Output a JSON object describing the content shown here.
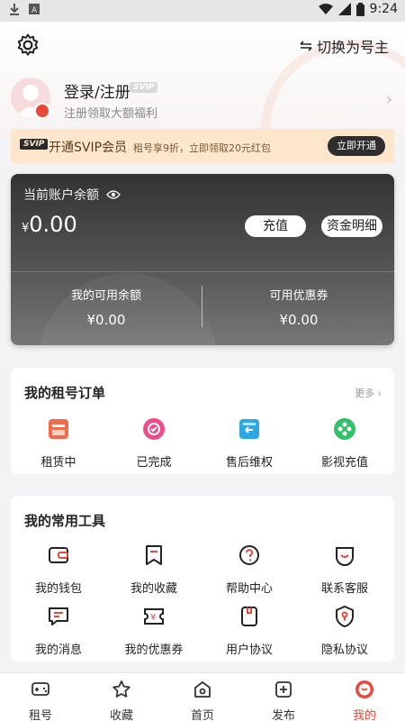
{
  "status": {
    "time": "9:24"
  },
  "header": {
    "switch_role": "切换为号主"
  },
  "user": {
    "login": "登录/注册",
    "svip_tag": "SVIP",
    "subtitle": "注册领取大额福利"
  },
  "svip_banner": {
    "badge": "SVIP",
    "title": "开通SVIP会员",
    "desc": "租号享9折，立即领取20元红包",
    "button": "立即开通"
  },
  "balance": {
    "label": "当前账户余额",
    "currency": "¥",
    "amount": "0.00",
    "recharge": "充值",
    "details": "资金明细",
    "available_label": "我的可用余额",
    "available_value": "¥0.00",
    "coupon_label": "可用优惠券",
    "coupon_value": "¥0.00"
  },
  "orders": {
    "title": "我的租号订单",
    "more": "更多",
    "items": [
      {
        "label": "租赁中",
        "icon": "renting-icon",
        "color": "#f26b4a"
      },
      {
        "label": "已完成",
        "icon": "completed-icon",
        "color": "#f04b8a"
      },
      {
        "label": "售后维权",
        "icon": "after-sales-icon",
        "color": "#2da7e0"
      },
      {
        "label": "影视充值",
        "icon": "video-recharge-icon",
        "color": "#33c06a"
      }
    ]
  },
  "tools": {
    "title": "我的常用工具",
    "items": [
      {
        "label": "我的钱包",
        "icon": "wallet-icon"
      },
      {
        "label": "我的收藏",
        "icon": "favorites-icon"
      },
      {
        "label": "帮助中心",
        "icon": "help-icon"
      },
      {
        "label": "联系客服",
        "icon": "customer-service-icon"
      },
      {
        "label": "我的消息",
        "icon": "message-icon"
      },
      {
        "label": "我的优惠券",
        "icon": "coupon-icon"
      },
      {
        "label": "用户协议",
        "icon": "user-agreement-icon"
      },
      {
        "label": "隐私协议",
        "icon": "privacy-icon"
      }
    ]
  },
  "tabbar": [
    {
      "label": "租号",
      "icon": "gamepad-icon"
    },
    {
      "label": "收藏",
      "icon": "star-icon"
    },
    {
      "label": "首页",
      "icon": "home-icon"
    },
    {
      "label": "发布",
      "icon": "publish-icon"
    },
    {
      "label": "我的",
      "icon": "profile-icon",
      "active": true
    }
  ],
  "colors": {
    "accent": "#e8493b",
    "card_dark": "#3a3a3a",
    "svip_bg": "#fde6cc"
  }
}
